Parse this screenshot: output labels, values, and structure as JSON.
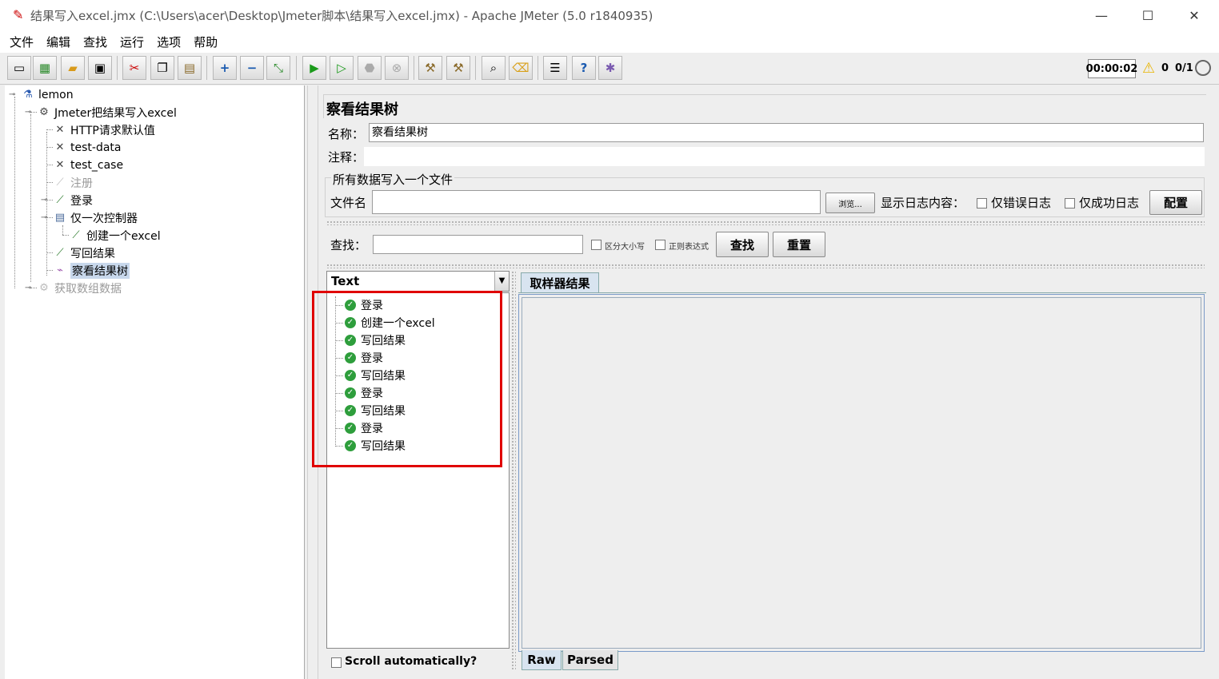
{
  "window": {
    "title": "结果写入excel.jmx (C:\\Users\\acer\\Desktop\\Jmeter脚本\\结果写入excel.jmx) - Apache JMeter (5.0 r1840935)",
    "minimize": "—",
    "maximize": "☐",
    "close": "✕"
  },
  "menu": [
    "文件",
    "编辑",
    "查找",
    "运行",
    "选项",
    "帮助"
  ],
  "toolbar": {
    "timer": "00:00:02",
    "error_count": "0",
    "threads": "0/1"
  },
  "tree": {
    "root": "lemon",
    "test_plan": "Jmeter把结果写入excel",
    "http_defaults": "HTTP请求默认值",
    "test_data": "test-data",
    "test_case": "test_case",
    "register": "注册",
    "login": "登录",
    "once_controller": "仅一次控制器",
    "create_excel": "创建一个excel",
    "write_back": "写回结果",
    "view_results_tree": "察看结果树",
    "get_array_data": "获取数组数据"
  },
  "panel": {
    "title": "察看结果树",
    "name_label": "名称：",
    "name_value": "察看结果树",
    "comment_label": "注释：",
    "comment_value": "",
    "file_group_title": "所有数据写入一个文件",
    "filename_label": "文件名",
    "filename_value": "",
    "browse_button": "浏览...",
    "log_content_label": "显示日志内容：",
    "errors_only_label": "仅错误日志",
    "success_only_label": "仅成功日志",
    "configure_button": "配置",
    "search_label": "查找：",
    "search_value": "",
    "case_sensitive_label": "区分大小写",
    "regex_label": "正则表达式",
    "search_button": "查找",
    "reset_button": "重置"
  },
  "results": {
    "renderer": "Text",
    "items": [
      "登录",
      "创建一个excel",
      "写回结果",
      "登录",
      "写回结果",
      "登录",
      "写回结果",
      "登录",
      "写回结果"
    ],
    "scroll_auto_label": "Scroll automatically?"
  },
  "detail": {
    "tab_sampler_result": "取样器结果",
    "tab_raw": "Raw",
    "tab_parsed": "Parsed"
  }
}
